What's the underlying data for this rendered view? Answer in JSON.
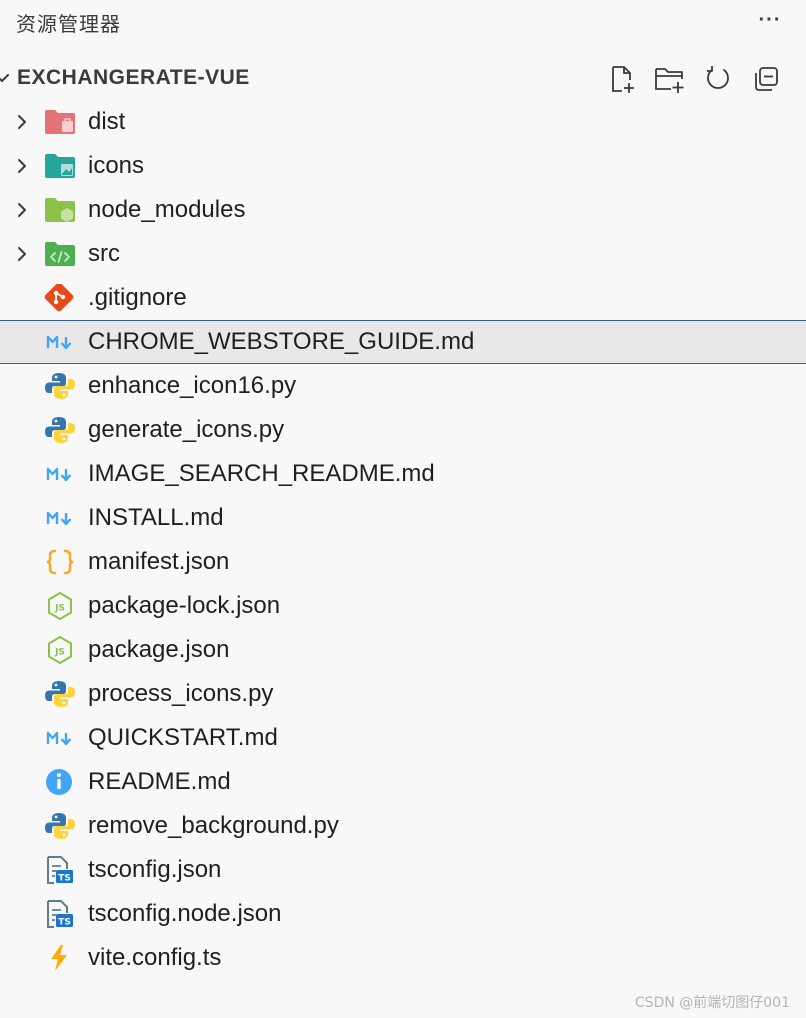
{
  "titlebar": {
    "title": "资源管理器",
    "more_label": "···"
  },
  "section": {
    "title": "EXCHANGERATE-VUE",
    "actions": [
      {
        "name": "new-file-icon"
      },
      {
        "name": "new-folder-icon"
      },
      {
        "name": "refresh-icon"
      },
      {
        "name": "collapse-all-icon"
      }
    ]
  },
  "tree": [
    {
      "label": "dist",
      "icon": "folder-dist-icon",
      "folder": true
    },
    {
      "label": "icons",
      "icon": "folder-images-icon",
      "folder": true
    },
    {
      "label": "node_modules",
      "icon": "folder-node-icon",
      "folder": true
    },
    {
      "label": "src",
      "icon": "folder-src-icon",
      "folder": true
    },
    {
      "label": ".gitignore",
      "icon": "git-icon",
      "folder": false
    },
    {
      "label": "CHROME_WEBSTORE_GUIDE.md",
      "icon": "markdown-icon",
      "folder": false,
      "selected": true
    },
    {
      "label": "enhance_icon16.py",
      "icon": "python-icon",
      "folder": false
    },
    {
      "label": "generate_icons.py",
      "icon": "python-icon",
      "folder": false
    },
    {
      "label": "IMAGE_SEARCH_README.md",
      "icon": "markdown-icon",
      "folder": false
    },
    {
      "label": "INSTALL.md",
      "icon": "markdown-icon",
      "folder": false
    },
    {
      "label": "manifest.json",
      "icon": "json-icon",
      "folder": false
    },
    {
      "label": "package-lock.json",
      "icon": "nodejs-icon",
      "folder": false
    },
    {
      "label": "package.json",
      "icon": "nodejs-icon",
      "folder": false
    },
    {
      "label": "process_icons.py",
      "icon": "python-icon",
      "folder": false
    },
    {
      "label": "QUICKSTART.md",
      "icon": "markdown-icon",
      "folder": false
    },
    {
      "label": "README.md",
      "icon": "info-icon",
      "folder": false
    },
    {
      "label": "remove_background.py",
      "icon": "python-icon",
      "folder": false
    },
    {
      "label": "tsconfig.json",
      "icon": "tsconfig-icon",
      "folder": false
    },
    {
      "label": "tsconfig.node.json",
      "icon": "tsconfig-icon",
      "folder": false
    },
    {
      "label": "vite.config.ts",
      "icon": "vite-icon",
      "folder": false
    }
  ],
  "watermark": "CSDN @前端切图仔001",
  "colors": {
    "selection_border": "#2f5fa8",
    "selection_bg": "#e8e8e8",
    "folder_dist": "#e57373",
    "folder_images": "#26a69a",
    "folder_node": "#8bc34a",
    "folder_src": "#4caf50",
    "markdown": "#42a5f5",
    "json": "#f9a825",
    "python_blue": "#3776ab",
    "python_yellow": "#ffd43b"
  }
}
